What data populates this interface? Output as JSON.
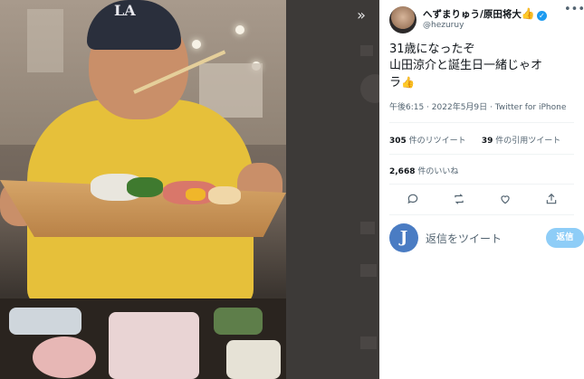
{
  "photo": {
    "cap_logo": "LA"
  },
  "viewer": {
    "expand_icon": "»"
  },
  "tweet": {
    "display_name": "へずまりゅう/原田将大",
    "name_emoji": "👍",
    "verified_mark": "✓",
    "handle": "@hezuruy",
    "more_icon": "•••",
    "text_line1": "31歳になったぞ",
    "text_line2": "山田涼介と誕生日一緒じゃオ",
    "text_line3": "ラ",
    "text_emoji": "👍",
    "timestamp": "午後6:15 · 2022年5月9日 · Twitter for iPhone",
    "retweets_count": "305",
    "retweets_label": "件のリツイート",
    "quotes_count": "39",
    "quotes_label": "件の引用ツイート",
    "likes_count": "2,668",
    "likes_label": "件のいいね"
  },
  "reply": {
    "avatar_letter": "J",
    "placeholder": "返信をツイート",
    "button_label": "返信"
  },
  "colors": {
    "accent": "#1d9bf0",
    "reply_button": "#8ecdf7",
    "text_primary": "#0f1419",
    "text_secondary": "#536471"
  }
}
